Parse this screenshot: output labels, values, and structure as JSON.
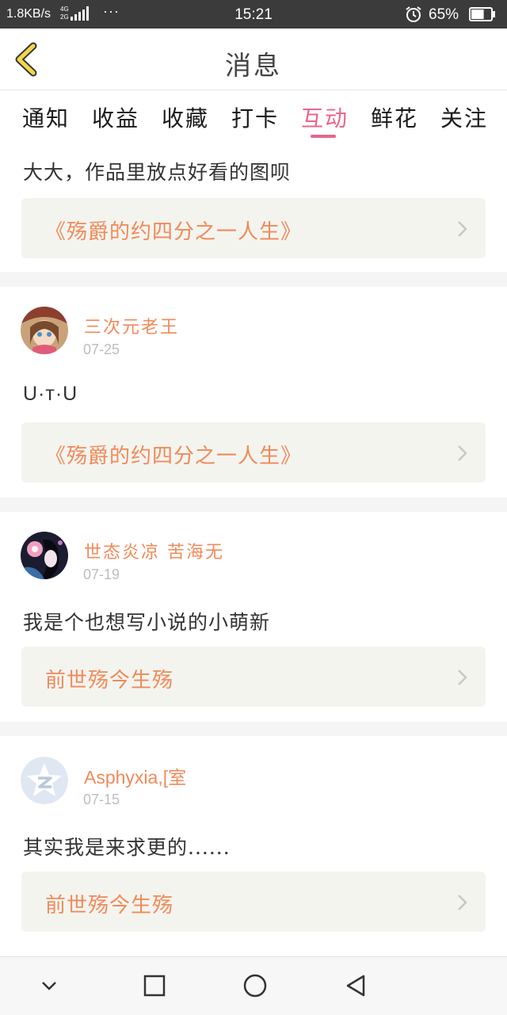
{
  "status_bar": {
    "speed": "1.8KB/s",
    "net_4g": "4G",
    "net_2g": "2G",
    "dots": "···",
    "time": "15:21",
    "battery": "65%",
    "battery_level": 0.65
  },
  "header": {
    "title": "消息",
    "back_icon": "chevron-left-icon"
  },
  "tabs": [
    {
      "label": "通知"
    },
    {
      "label": "收益"
    },
    {
      "label": "收藏"
    },
    {
      "label": "打卡"
    },
    {
      "label": "互动",
      "active": true
    },
    {
      "label": "鲜花"
    },
    {
      "label": "关注"
    }
  ],
  "items": [
    {
      "message": "大大，作品里放点好看的图呗",
      "work": "《殇爵的约四分之一人生》"
    },
    {
      "user": "三次元老王",
      "date": "07-25",
      "message": "U·ᴛ·U",
      "work": "《殇爵的约四分之一人生》"
    },
    {
      "user": "世态炎凉 苦海无",
      "date": "07-19",
      "message": "我是个也想写小说的小萌新",
      "work": "前世殇今生殇"
    },
    {
      "user": "Asphyxia,[室",
      "date": "07-15",
      "message": "其实我是来求更的......",
      "work": "前世殇今生殇"
    }
  ],
  "colors": {
    "accent": "#e8668c",
    "link_orange": "#ef8a5a",
    "back_arrow": "#f2d64b",
    "card_bg": "#f4f4ef"
  },
  "bottom_nav": [
    "chevron-down-icon",
    "square-icon",
    "circle-icon",
    "triangle-back-icon"
  ]
}
